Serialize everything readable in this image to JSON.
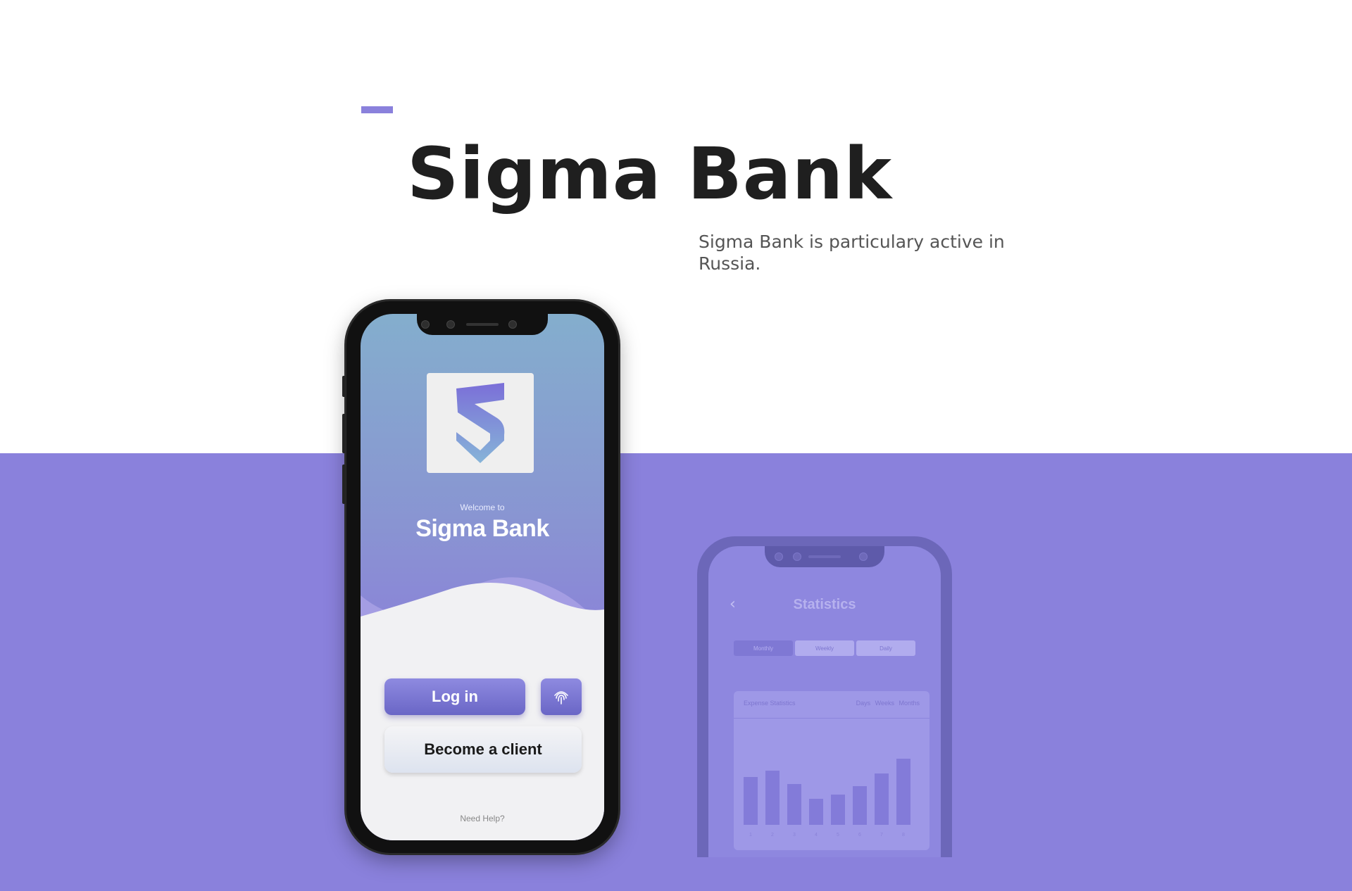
{
  "hero": {
    "title": "Sigma Bank",
    "tagline": "Sigma Bank is particulary active in Russia."
  },
  "front_phone": {
    "welcome": "Welcome to",
    "app_title": "Sigma Bank",
    "login_label": "Log in",
    "client_label": "Become a client",
    "help_label": "Need Help?"
  },
  "back_phone": {
    "screen_title": "Statistics",
    "tabs": [
      "Monthly",
      "Weekly",
      "Daily"
    ],
    "card_title": "Expense Statistics",
    "card_tabs": "Days Weeks Months",
    "bar_values": [
      0.57,
      0.64,
      0.48,
      0.31,
      0.36,
      0.46,
      0.61,
      0.78
    ],
    "bar_labels": [
      "1",
      "2",
      "3",
      "4",
      "5",
      "6",
      "7",
      "8"
    ]
  },
  "colors": {
    "accent": "#8a81dc",
    "title": "#1f1f1f"
  },
  "icons": [
    "sigma-shield-logo-icon",
    "fingerprint-icon",
    "back-arrow-icon"
  ]
}
